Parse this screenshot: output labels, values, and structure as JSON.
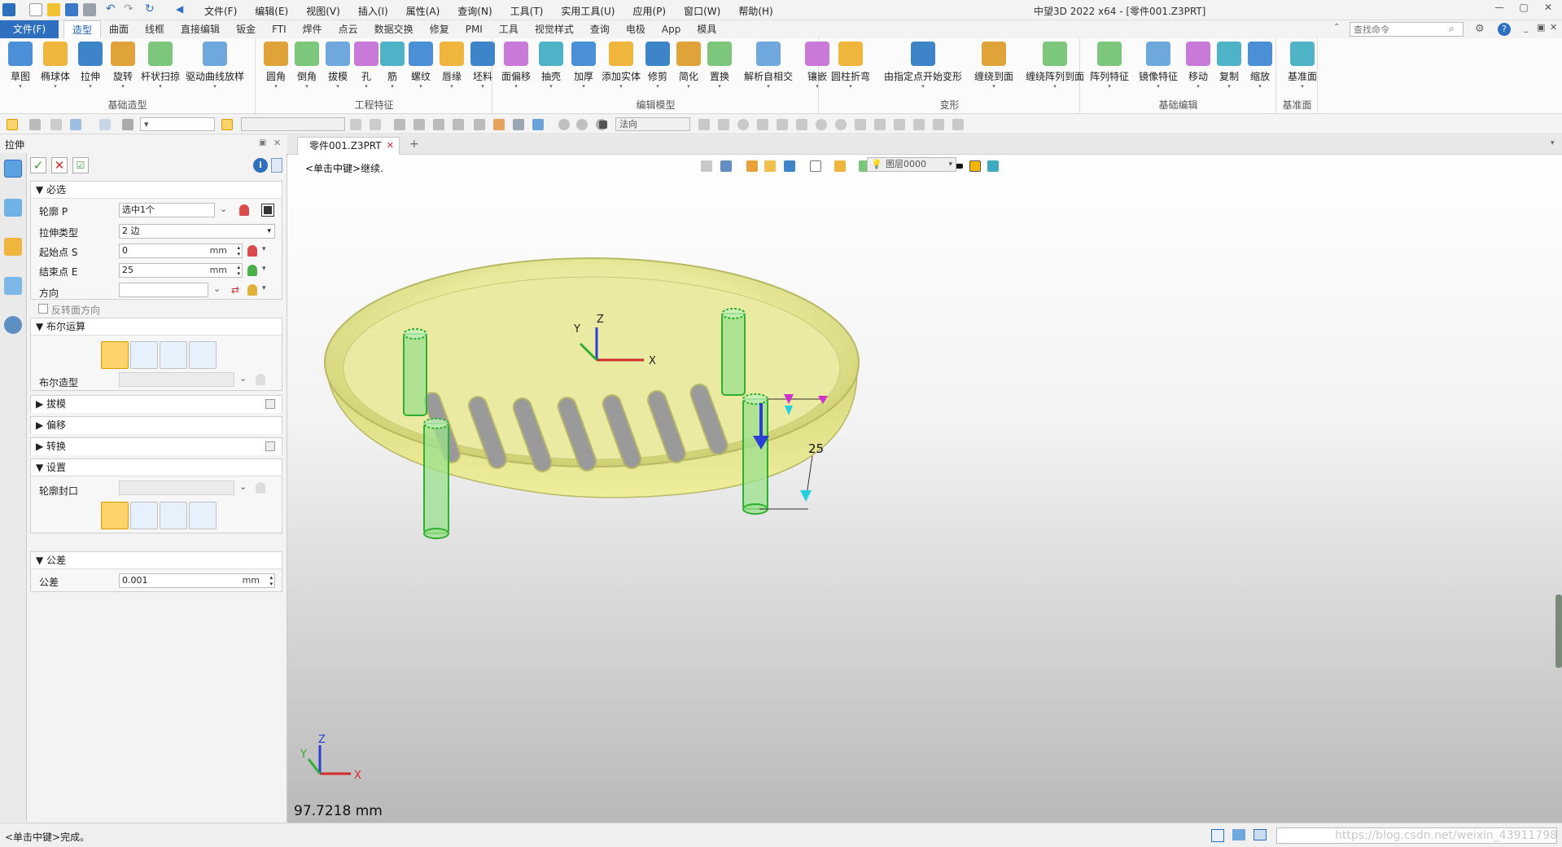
{
  "app": {
    "title": "中望3D 2022 x64 - [零件001.Z3PRT]",
    "menus": [
      "文件(F)",
      "编辑(E)",
      "视图(V)",
      "插入(I)",
      "属性(A)",
      "查询(N)",
      "工具(T)",
      "实用工具(U)",
      "应用(P)",
      "窗口(W)",
      "帮助(H)"
    ]
  },
  "ribbon": {
    "file_tab": "文件(F)",
    "tabs": [
      "造型",
      "曲面",
      "线框",
      "直接编辑",
      "钣金",
      "FTI",
      "焊件",
      "点云",
      "数据交换",
      "修复",
      "PMI",
      "工具",
      "视觉样式",
      "查询",
      "电极",
      "App",
      "模具"
    ],
    "active_tab": "造型",
    "search_placeholder": "查找命令",
    "groups": [
      {
        "label": "基础造型",
        "buttons": [
          "草图",
          "椭球体",
          "拉伸",
          "旋转",
          "杆状扫掠",
          "驱动曲线放样"
        ]
      },
      {
        "label": "工程特征",
        "buttons": [
          "圆角",
          "倒角",
          "拔模",
          "孔",
          "筋",
          "螺纹",
          "唇缘",
          "坯料"
        ]
      },
      {
        "label": "编辑模型",
        "buttons": [
          "面偏移",
          "抽壳",
          "加厚",
          "添加实体",
          "修剪",
          "简化",
          "置换",
          "解析自相交",
          "镶嵌"
        ]
      },
      {
        "label": "变形",
        "buttons": [
          "圆柱折弯",
          "由指定点开始变形",
          "缠绕到面",
          "缠绕阵列到面"
        ]
      },
      {
        "label": "基础编辑",
        "buttons": [
          "阵列特征",
          "镜像特征",
          "移动",
          "复制",
          "缩放"
        ]
      },
      {
        "label": "基准面",
        "buttons": [
          "基准面"
        ]
      }
    ]
  },
  "toolbar": {
    "filter_value": "法向"
  },
  "panel": {
    "title": "拉伸",
    "sections": {
      "required": "必选",
      "boolean": "布尔运算",
      "draft": "拔模",
      "offset": "偏移",
      "transform": "转换",
      "settings": "设置",
      "tolerance": "公差"
    },
    "fields": {
      "profile_label": "轮廓 P",
      "profile_value": "选中1个",
      "extrude_type_label": "拉伸类型",
      "extrude_type_value": "2 边",
      "start_label": "起始点 S",
      "start_value": "0",
      "end_label": "结束点 E",
      "end_value": "25",
      "unit": "mm",
      "direction_label": "方向",
      "flip_label": "反转面方向",
      "bool_shape_label": "布尔造型",
      "profile_cap_label": "轮廓封口",
      "tolerance_label": "公差",
      "tolerance_value": "0.001"
    }
  },
  "document": {
    "tab_name": "零件001.Z3PRT",
    "hint": "<单击中键>继续.",
    "layer": "图层0000",
    "distance": "97.7218 mm",
    "dimension": "25",
    "axis_x": "X",
    "axis_y": "Y",
    "axis_z": "Z"
  },
  "status": {
    "text": "<单击中键>完成。",
    "watermark": "https://blog.csdn.net/weixin_43911798"
  },
  "colors": {
    "accent": "#2f6fc0",
    "model_yellow": "#e4e58a",
    "pin_green": "#9be08d"
  }
}
